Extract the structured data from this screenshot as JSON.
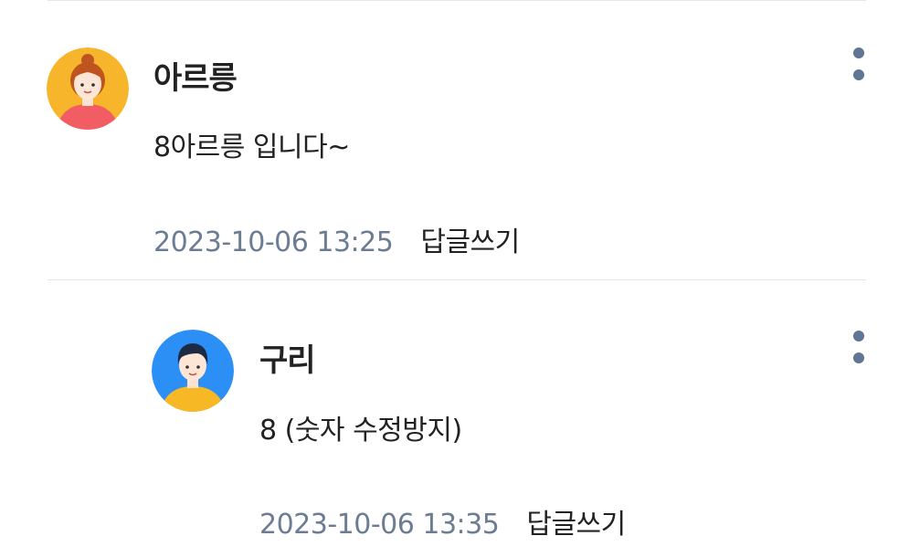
{
  "comments": [
    {
      "author": "아르릉",
      "text": "8아르릉 입니다~",
      "timestamp": "2023-10-06 13:25",
      "reply_label": "답글쓰기",
      "avatar": "female-avatar-icon"
    },
    {
      "author": "구리",
      "text": "8 (숫자 수정방지)",
      "timestamp": "2023-10-06 13:35",
      "reply_label": "답글쓰기",
      "avatar": "male-avatar-icon",
      "is_reply": true
    }
  ],
  "colors": {
    "timestamp": "#6b7c93",
    "more_dots": "#5e7593",
    "avatar1_bg": "#f7b52c",
    "avatar2_bg": "#2b8ff6"
  }
}
